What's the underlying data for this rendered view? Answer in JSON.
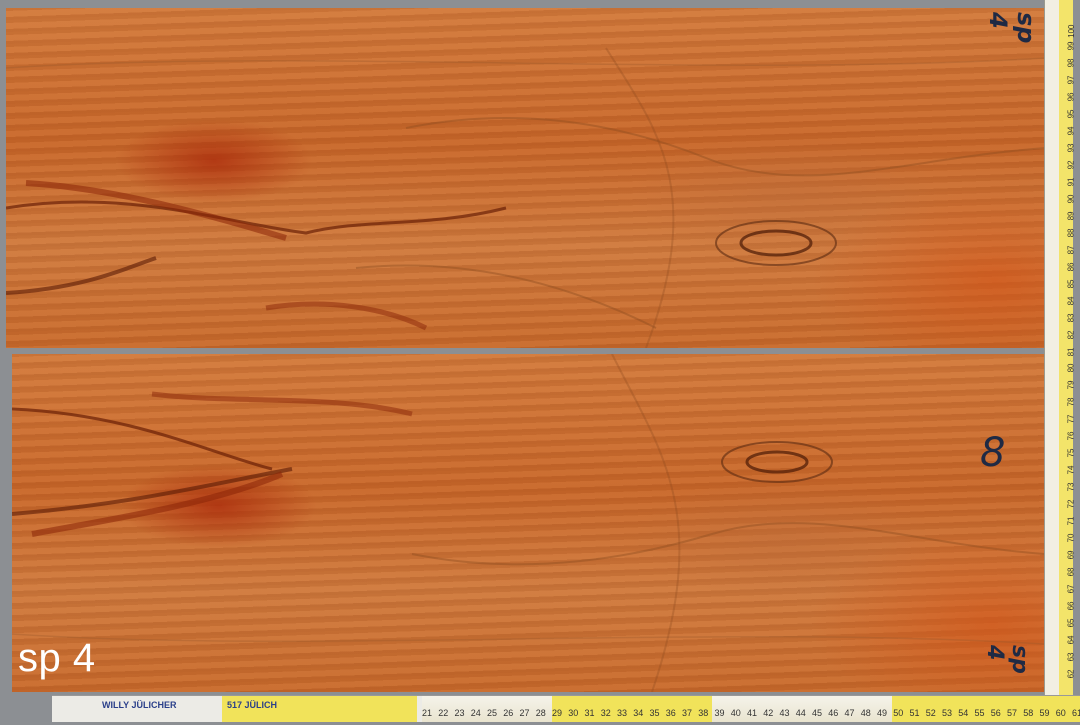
{
  "photo": {
    "caption": "sp 4",
    "marks": {
      "top_right": "sp 4",
      "middle_right": "8",
      "bottom_right": "sp 4"
    }
  },
  "ruler_horizontal": {
    "brand": "WILLY JÜLICHER",
    "model": "517 JÜLICH",
    "numbers": [
      "21",
      "22",
      "23",
      "24",
      "25",
      "26",
      "27",
      "28",
      "29",
      "30",
      "31",
      "32",
      "33",
      "34",
      "35",
      "36",
      "37",
      "38",
      "39",
      "40",
      "41",
      "42",
      "43",
      "44",
      "45",
      "46",
      "47",
      "48",
      "49",
      "50",
      "51",
      "52",
      "53",
      "54",
      "55",
      "56",
      "57",
      "58",
      "59",
      "60",
      "61"
    ]
  },
  "ruler_vertical": {
    "numbers": [
      "100",
      "99",
      "98",
      "97",
      "96",
      "95",
      "94",
      "93",
      "92",
      "91",
      "90",
      "89",
      "88",
      "87",
      "86",
      "85",
      "84",
      "83",
      "82",
      "81",
      "80",
      "79",
      "78",
      "77",
      "76",
      "75",
      "74",
      "73",
      "72",
      "71",
      "70",
      "69",
      "68",
      "67",
      "66",
      "65",
      "64",
      "63",
      "62"
    ]
  },
  "colors": {
    "background": "#8c8f93",
    "wood": "#cf7a3e",
    "wood_dark_figure": "#a0280a",
    "ruler_yellow": "#f1e35a"
  }
}
